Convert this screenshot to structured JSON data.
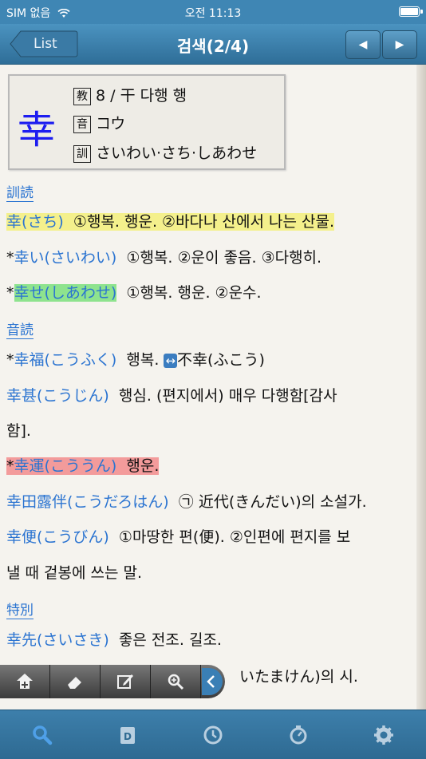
{
  "status_bar": {
    "carrier": "SIM 없음",
    "time": "오전 11:13"
  },
  "nav": {
    "back_label": "List",
    "title": "검색(2/4)",
    "prev_symbol": "◀",
    "next_symbol": "▶"
  },
  "kanji_card": {
    "kanji": "幸",
    "grade_badge": "教",
    "grade_text": "8 / 干 다행 행",
    "on_badge": "音",
    "on_text": "コウ",
    "kun_badge": "訓",
    "kun_text": "さいわい·さち·しあわせ"
  },
  "section_kun": "訓読",
  "entries_kun": [
    {
      "prefix": "",
      "word": "幸(さち)",
      "meaning": "①행복. 행운. ②바다나 산에서 나는 산물."
    },
    {
      "prefix": "*",
      "word": "幸い(さいわい)",
      "meaning": "①행복. ②운이 좋음. ③다행히."
    },
    {
      "prefix": "*",
      "word": "幸せ(しあわせ)",
      "meaning": "①행복. 행운. ②운수."
    }
  ],
  "section_on": "音読",
  "entries_on": [
    {
      "prefix": "*",
      "word": "幸福(こうふく)",
      "meaning_a": "행복.",
      "arrow": "↔",
      "meaning_b": "不幸(ふこう)"
    },
    {
      "prefix": "",
      "word": "幸甚(こうじん)",
      "meaning": "행심. (편지에서) 매우 다행함[감사",
      "meaning_cont": "함]."
    },
    {
      "prefix": "*",
      "word": "幸運(こううん)",
      "meaning": "행운."
    },
    {
      "prefix": "",
      "word": "幸田露伴(こうだろはん)",
      "meaning": "㉠ 近代(きんだい)의 소설가."
    },
    {
      "prefix": "",
      "word": "幸便(こうびん)",
      "meaning": "①마땅한 편(便). ②인편에 편지를 보",
      "meaning_cont": "낼 때 겉봉에 쓰는 말."
    }
  ],
  "section_special": "特別",
  "entries_special": [
    {
      "prefix": "",
      "word": "幸先(さいさき)",
      "meaning": "좋은 전조. 길조."
    },
    {
      "prefix": "",
      "partial": "いたまけん)의 시."
    }
  ],
  "toolbar": {
    "icons": [
      "add-bookmark-icon",
      "eraser-icon",
      "edit-icon",
      "zoom-icon",
      "collapse-icon"
    ]
  },
  "tabs": [
    "search-tab",
    "daily-tab",
    "history-tab",
    "timer-tab",
    "settings-tab"
  ]
}
